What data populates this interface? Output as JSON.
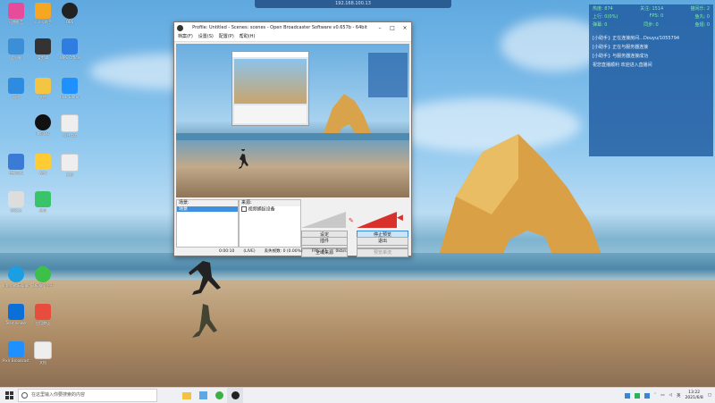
{
  "desktop_icons": [
    {
      "label": "迅雷影音",
      "color": "#e74c9a"
    },
    {
      "label": "公众号助手",
      "color": "#f5a623"
    },
    {
      "label": "OBS",
      "color": "#222"
    },
    {
      "label": "此电脑",
      "color": "#3b8fd6"
    },
    {
      "label": "爱剪辑",
      "color": "#333"
    },
    {
      "label": "WPS Office",
      "color": "#2f7de1"
    },
    {
      "label": "网络",
      "color": "#2d8be0"
    },
    {
      "label": "文件",
      "color": "#f4c542"
    },
    {
      "label": "Pixlr Editor",
      "color": "#1e90ff"
    },
    {
      "label": "腾讯QQ",
      "color": "#111"
    },
    {
      "label": "文件.txt",
      "color": "#eee"
    },
    {
      "label": "控制面板",
      "color": "#3a7bd5"
    },
    {
      "label": "视频",
      "color": "#ffcc33"
    },
    {
      "label": "文档",
      "color": "#eee"
    },
    {
      "label": "回收站",
      "color": "#ddd"
    },
    {
      "label": "应用",
      "color": "#39c36a"
    },
    {
      "label": "Internet Explorer",
      "color": "#1b9fe2"
    },
    {
      "label": "360安全卫士",
      "color": "#3cc04a"
    },
    {
      "label": "TeamViewer",
      "color": "#0b6fd8"
    },
    {
      "label": "应用商店",
      "color": "#e84c3d"
    },
    {
      "label": "Pixlr Broadcaster",
      "color": "#1e90ff"
    },
    {
      "label": "文档",
      "color": "#eee"
    }
  ],
  "remote_bar": {
    "text": "192.168.100.13"
  },
  "obs": {
    "title": "Profile: Untitled - Scenes: scenes - Open Broadcaster Software v0.657b - 64bit",
    "menu": [
      "档案(F)",
      "设置(S)",
      "配置(P)",
      "帮助(H)"
    ],
    "scenes_header": "场景:",
    "scene_selected": "场景",
    "sources_header": "来源:",
    "source_item": "视频捕捉设备",
    "buttons": {
      "settings": "设定",
      "stop_preview": "停止预览",
      "edit_scene": "编辑场景",
      "start_record": "开始录制",
      "global_sources": "全域来源",
      "plugins": "插件",
      "exit": "退出",
      "disabled_btn": "预览串流"
    },
    "status": {
      "time": "0:00:10",
      "fps_label": "(LIVE)",
      "dropped": "丢失帧数: 0 (0.00%)",
      "fps": "FPS: 47",
      "rate": "0kb/s"
    }
  },
  "info_panel": {
    "stats": [
      {
        "label": "热度:",
        "value": "874"
      },
      {
        "label": "关注:",
        "value": "1514"
      },
      {
        "label": "猫闲乐:",
        "value": "2"
      },
      {
        "label": "上行:",
        "value": "0(0%)"
      },
      {
        "label": "FPS:",
        "value": "0"
      },
      {
        "label": "鱼丸:",
        "value": "0"
      },
      {
        "label": "弹幕:",
        "value": "0"
      },
      {
        "label": "同步:",
        "value": "0"
      },
      {
        "label": "鱼翅:",
        "value": "0"
      }
    ],
    "messages": [
      "[小助手]: 正在连接房间...Douyu/1055794",
      "[小助手]: 正在与服务器连接",
      "[小助手]: 与服务器连接成功",
      "祝您直播顺利 欢迎进入直播间"
    ]
  },
  "taskbar": {
    "search_placeholder": "在这里输入你要搜索的内容",
    "time": "13:22",
    "date": "2021/6/8",
    "lang": "英"
  }
}
